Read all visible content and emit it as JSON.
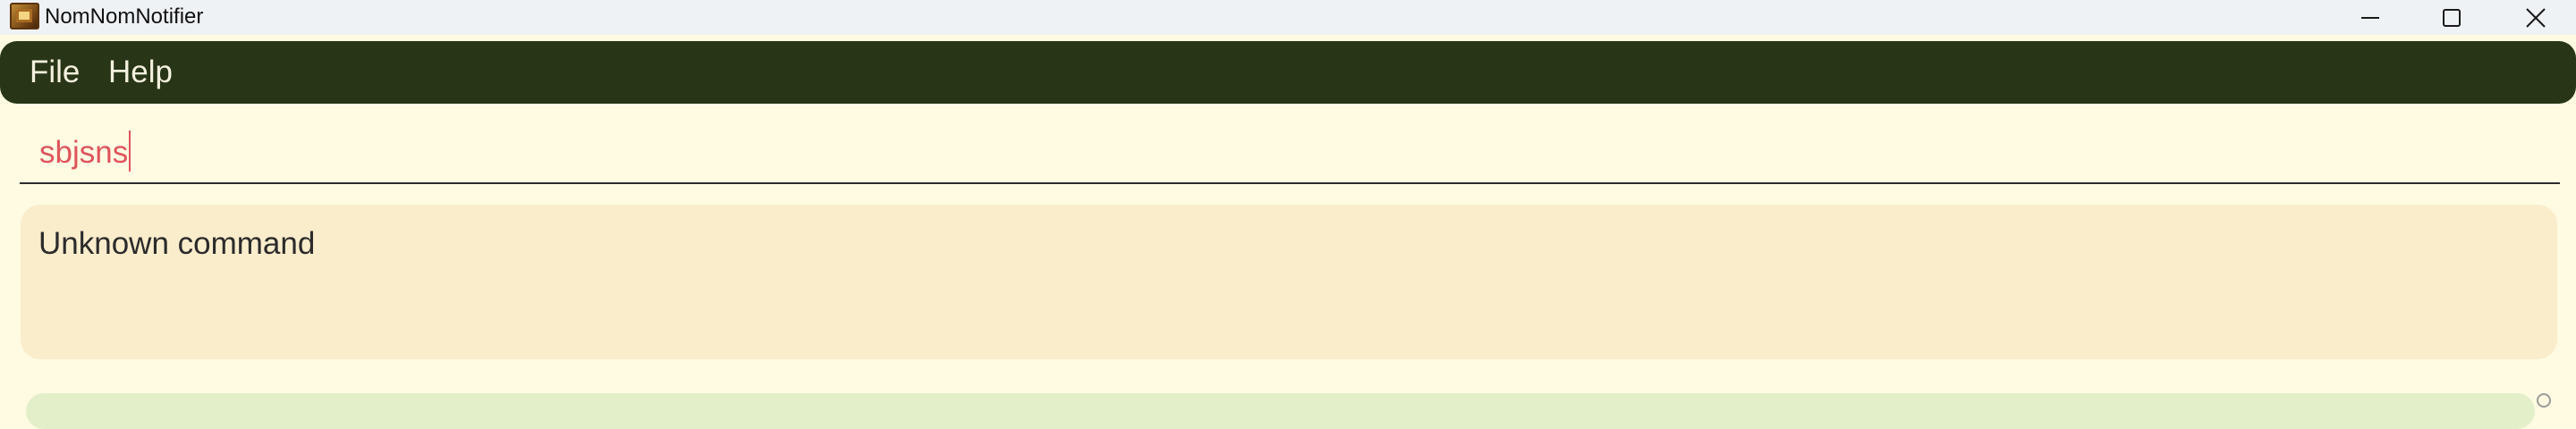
{
  "window": {
    "title": "NomNomNotifier",
    "icon": "app-logo-icon",
    "controls": {
      "minimize_icon": "minimize-icon",
      "maximize_icon": "maximize-icon",
      "close_icon": "close-icon"
    }
  },
  "menubar": {
    "items": [
      {
        "label": "File"
      },
      {
        "label": "Help"
      }
    ]
  },
  "command_box": {
    "value": "sbjsns"
  },
  "result_display": {
    "text": "Unknown command"
  },
  "colors": {
    "background": "#fefbe2",
    "menubar": "#283517",
    "menu_text": "#f4f1df",
    "command_text": "#e0545c",
    "result_background": "#faedcc",
    "list_background": "#e3efc8"
  }
}
